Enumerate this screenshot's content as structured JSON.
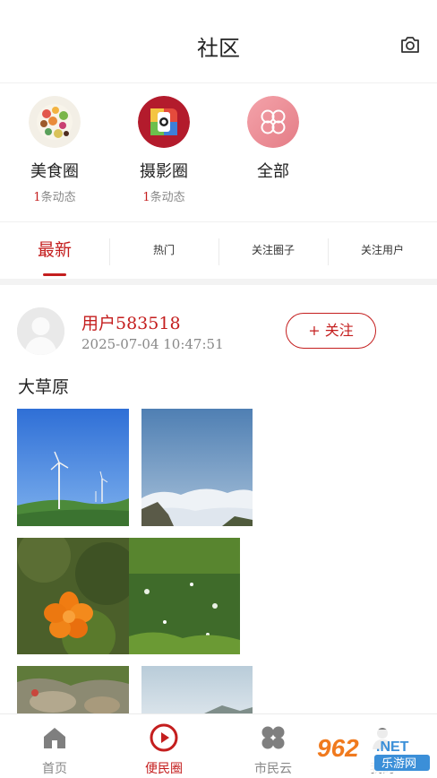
{
  "header": {
    "title": "社区"
  },
  "circles": [
    {
      "name": "美食圈",
      "count_num": "1",
      "count_suffix": "条动态"
    },
    {
      "name": "摄影圈",
      "count_num": "1",
      "count_suffix": "条动态"
    },
    {
      "name": "全部"
    }
  ],
  "tabs": [
    {
      "label": "最新"
    },
    {
      "label": "热门"
    },
    {
      "label": "关注圈子"
    },
    {
      "label": "关注用户"
    }
  ],
  "post": {
    "username": "用户583518",
    "time": "2025-07-04 10:47:51",
    "follow_label": "+ 关注",
    "text": "大草原"
  },
  "nav": [
    {
      "label": "首页"
    },
    {
      "label": "便民圈"
    },
    {
      "label": "市民云"
    },
    {
      "label": "我的"
    }
  ],
  "watermark": {
    "brand": "962",
    "net": ".NET",
    "site": "乐游网"
  },
  "colors": {
    "accent": "#c41e1e",
    "muted": "#888888"
  }
}
